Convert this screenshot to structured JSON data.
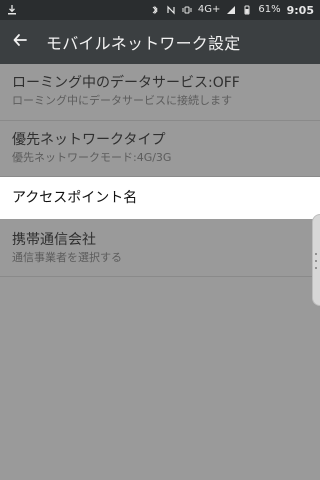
{
  "status_bar": {
    "battery_percent": "61%",
    "time": "9:05",
    "network": "4G+"
  },
  "app_bar": {
    "title": "モバイルネットワーク設定"
  },
  "settings": [
    {
      "label": "ローミング中のデータサービス:OFF",
      "subtitle": "ローミング中にデータサービスに接続します"
    },
    {
      "label": "優先ネットワークタイプ",
      "subtitle": "優先ネットワークモード:4G/3G"
    },
    {
      "label": "アクセスポイント名"
    },
    {
      "label": "携帯通信会社",
      "subtitle": "通信事業者を選択する"
    }
  ]
}
